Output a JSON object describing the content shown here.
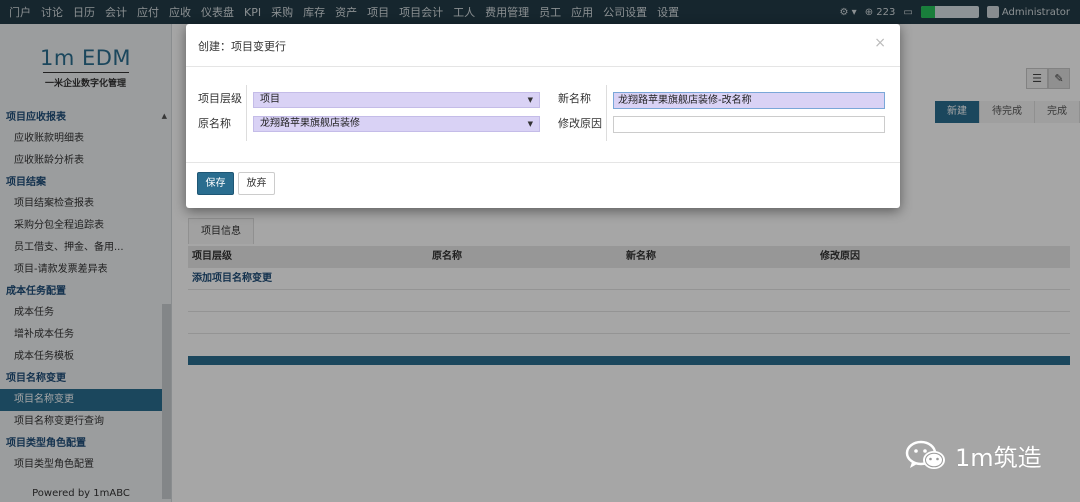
{
  "topnav": {
    "items": [
      "门户",
      "讨论",
      "日历",
      "会计",
      "应付",
      "应收",
      "仪表盘",
      "KPI",
      "采购",
      "库存",
      "资产",
      "项目",
      "项目会计",
      "工人",
      "费用管理",
      "员工",
      "应用",
      "公司设置",
      "设置"
    ],
    "count": "223",
    "user": "Administrator"
  },
  "sidebar": {
    "logo_main": "1m EDM",
    "logo_sub": "一米企业数字化管理",
    "groups": [
      {
        "title": "项目应收报表",
        "items": [
          "应收账款明细表",
          "应收账龄分析表"
        ]
      },
      {
        "title": "项目结案",
        "items": [
          "项目结案检查报表",
          "采购分包全程追踪表",
          "员工借支、押金、备用...",
          "项目-请款发票差异表"
        ]
      },
      {
        "title": "成本任务配置",
        "items": [
          "成本任务",
          "增补成本任务",
          "成本任务模板"
        ]
      },
      {
        "title": "项目名称变更",
        "items": [
          "项目名称变更",
          "项目名称变更行查询"
        ]
      },
      {
        "title": "项目类型角色配置",
        "items": [
          "项目类型角色配置"
        ]
      }
    ],
    "active_item": "项目名称变更",
    "powered_by": "Powered by 1mABC"
  },
  "main": {
    "stages": [
      "新建",
      "待完成",
      "完成"
    ],
    "tab": "项目信息",
    "columns": [
      "项目层级",
      "原名称",
      "新名称",
      "修改原因"
    ],
    "add_link": "添加项目名称变更"
  },
  "modal": {
    "title": "创建：项目变更行",
    "fields": {
      "level_label": "项目层级",
      "level_value": "项目",
      "orig_label": "原名称",
      "orig_value": "龙翔路苹果旗舰店装修",
      "new_label": "新名称",
      "new_value": "龙翔路苹果旗舰店装修-改名称",
      "reason_label": "修改原因",
      "reason_value": ""
    },
    "save_label": "保存",
    "discard_label": "放弃"
  },
  "watermark": "1m筑造"
}
